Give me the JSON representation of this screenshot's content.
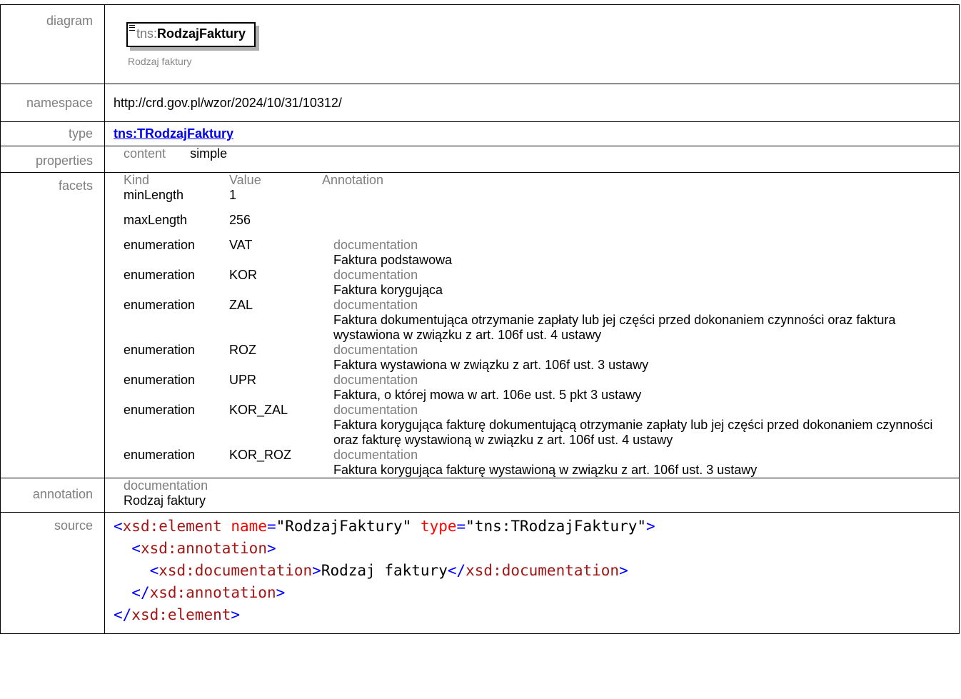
{
  "labels": {
    "diagram": "diagram",
    "namespace": "namespace",
    "type": "type",
    "properties": "properties",
    "facets": "facets",
    "annotation": "annotation",
    "source": "source"
  },
  "diagram": {
    "prefix": "tns:",
    "name": "RodzajFaktury",
    "caption": "Rodzaj faktury"
  },
  "namespace": "http://crd.gov.pl/wzor/2024/10/31/10312/",
  "type": "tns:TRodzajFaktury",
  "properties": {
    "key": "content",
    "value": "simple"
  },
  "facets": {
    "headers": {
      "kind": "Kind",
      "value": "Value",
      "annotation": "Annotation"
    },
    "rows": [
      {
        "kind": "minLength",
        "value": "1",
        "doc_label": "",
        "doc": ""
      },
      {
        "kind": "maxLength",
        "value": "256",
        "doc_label": "",
        "doc": ""
      },
      {
        "kind": "enumeration",
        "value": "VAT",
        "doc_label": "documentation",
        "doc": "Faktura podstawowa"
      },
      {
        "kind": "enumeration",
        "value": "KOR",
        "doc_label": "documentation",
        "doc": "Faktura korygująca"
      },
      {
        "kind": "enumeration",
        "value": "ZAL",
        "doc_label": "documentation",
        "doc": "Faktura dokumentująca otrzymanie zapłaty lub jej części przed dokonaniem czynności oraz faktura wystawiona w związku z art. 106f ust. 4 ustawy"
      },
      {
        "kind": "enumeration",
        "value": "ROZ",
        "doc_label": "documentation",
        "doc": "Faktura wystawiona w związku z art. 106f ust. 3 ustawy"
      },
      {
        "kind": "enumeration",
        "value": "UPR",
        "doc_label": "documentation",
        "doc": "Faktura, o której mowa w art. 106e ust. 5 pkt 3 ustawy"
      },
      {
        "kind": "enumeration",
        "value": "KOR_ZAL",
        "doc_label": "documentation",
        "doc": "Faktura korygująca fakturę dokumentującą otrzymanie zapłaty lub jej części przed dokonaniem czynności oraz fakturę wystawioną w związku z art. 106f ust. 4 ustawy"
      },
      {
        "kind": "enumeration",
        "value": "KOR_ROZ",
        "doc_label": "documentation",
        "doc": "Faktura korygująca fakturę wystawioną w związku z art. 106f ust. 3 ustawy"
      }
    ]
  },
  "annotation": {
    "label": "documentation",
    "text": "Rodzaj faktury"
  },
  "source": {
    "el_open": "xsd:element",
    "attr_name": "name",
    "name_value": "\"RodzajFaktury\"",
    "attr_type": "type",
    "type_value": "\"tns:TRodzajFaktury\"",
    "ann_tag": "xsd:annotation",
    "doc_tag": "xsd:documentation",
    "doc_text": "Rodzaj faktury"
  },
  "colors": {
    "label_grey": "#7f7f7f",
    "link_blue": "#0000ee",
    "tag_red": "#a31515",
    "bracket_blue": "#0000ff",
    "attr_red": "#ff0000"
  }
}
